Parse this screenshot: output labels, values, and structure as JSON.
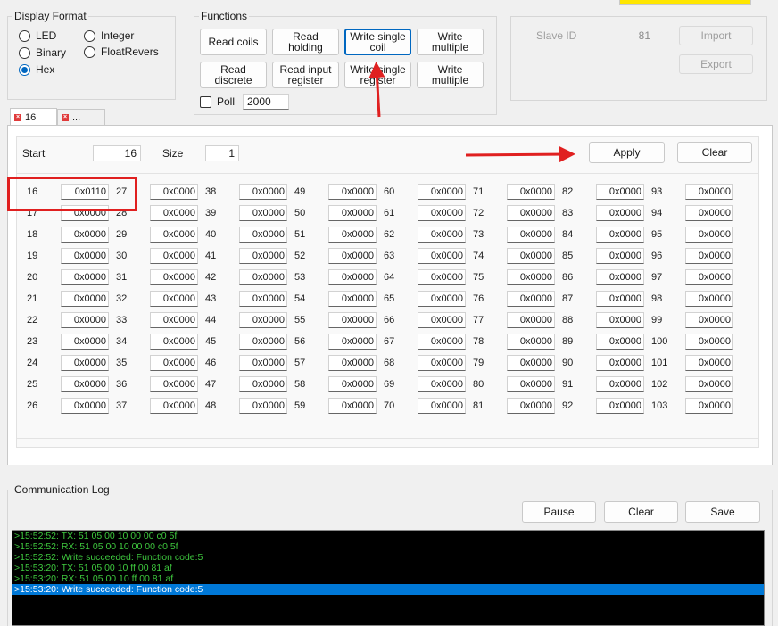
{
  "display_format": {
    "title": "Display Format",
    "options": [
      {
        "label": "LED",
        "checked": false
      },
      {
        "label": "Integer",
        "checked": false
      },
      {
        "label": "Binary",
        "checked": false
      },
      {
        "label": "FloatRevers",
        "checked": false
      },
      {
        "label": "Hex",
        "checked": true
      }
    ]
  },
  "functions": {
    "title": "Functions",
    "buttons": [
      "Read coils",
      "Read\nholding",
      "Write single\ncoil",
      "Write\nmultiple",
      "Read\ndiscrete",
      "Read input\nregister",
      "Write single\nregister",
      "Write\nmultiple"
    ],
    "poll_label": "Poll",
    "poll_checked": false,
    "poll_value": "2000"
  },
  "slave": {
    "label": "Slave ID",
    "value": "81",
    "import_label": "Import",
    "export_label": "Export"
  },
  "tabs": [
    {
      "label": "16"
    },
    {
      "label": "..."
    }
  ],
  "register_panel": {
    "start_label": "Start",
    "start_value": "16",
    "size_label": "Size",
    "size_value": "1",
    "apply_label": "Apply",
    "clear_label": "Clear"
  },
  "registers": {
    "start": 16,
    "count": 88,
    "rows": 11,
    "highlighted_index": 0,
    "values": [
      "0x0110",
      "0x0000",
      "0x0000",
      "0x0000",
      "0x0000",
      "0x0000",
      "0x0000",
      "0x0000",
      "0x0000",
      "0x0000",
      "0x0000",
      "0x0000",
      "0x0000",
      "0x0000",
      "0x0000",
      "0x0000",
      "0x0000",
      "0x0000",
      "0x0000",
      "0x0000",
      "0x0000",
      "0x0000",
      "0x0000",
      "0x0000",
      "0x0000",
      "0x0000",
      "0x0000",
      "0x0000",
      "0x0000",
      "0x0000",
      "0x0000",
      "0x0000",
      "0x0000",
      "0x0000",
      "0x0000",
      "0x0000",
      "0x0000",
      "0x0000",
      "0x0000",
      "0x0000",
      "0x0000",
      "0x0000",
      "0x0000",
      "0x0000",
      "0x0000",
      "0x0000",
      "0x0000",
      "0x0000",
      "0x0000",
      "0x0000",
      "0x0000",
      "0x0000",
      "0x0000",
      "0x0000",
      "0x0000",
      "0x0000",
      "0x0000",
      "0x0000",
      "0x0000",
      "0x0000",
      "0x0000",
      "0x0000",
      "0x0000",
      "0x0000",
      "0x0000",
      "0x0000",
      "0x0000",
      "0x0000",
      "0x0000",
      "0x0000",
      "0x0000",
      "0x0000",
      "0x0000",
      "0x0000",
      "0x0000",
      "0x0000",
      "0x0000",
      "0x0000",
      "0x0000",
      "0x0000",
      "0x0000",
      "0x0000",
      "0x0000",
      "0x0000",
      "0x0000",
      "0x0000",
      "0x0000",
      "0x0000"
    ]
  },
  "communication_log": {
    "title": "Communication Log",
    "pause_label": "Pause",
    "clear_label": "Clear",
    "save_label": "Save",
    "lines": [
      ">15:52:52: TX: 51 05 00 10 00 00 c0 5f",
      ">15:52:52: RX: 51 05 00 10 00 00 c0 5f",
      ">15:52:52: Write succeeded: Function code:5",
      ">15:53:20: TX: 51 05 00 10 ff 00 81 af",
      ">15:53:20: RX: 51 05 00 10 ff 00 81 af",
      ">15:53:20: Write succeeded: Function code:5"
    ],
    "selected_line": 5
  },
  "colors": {
    "annotation_red": "#e02020",
    "selection_blue": "#0078d7",
    "log_green": "#3ec83e",
    "top_strip_yellow": "#ffe600"
  }
}
